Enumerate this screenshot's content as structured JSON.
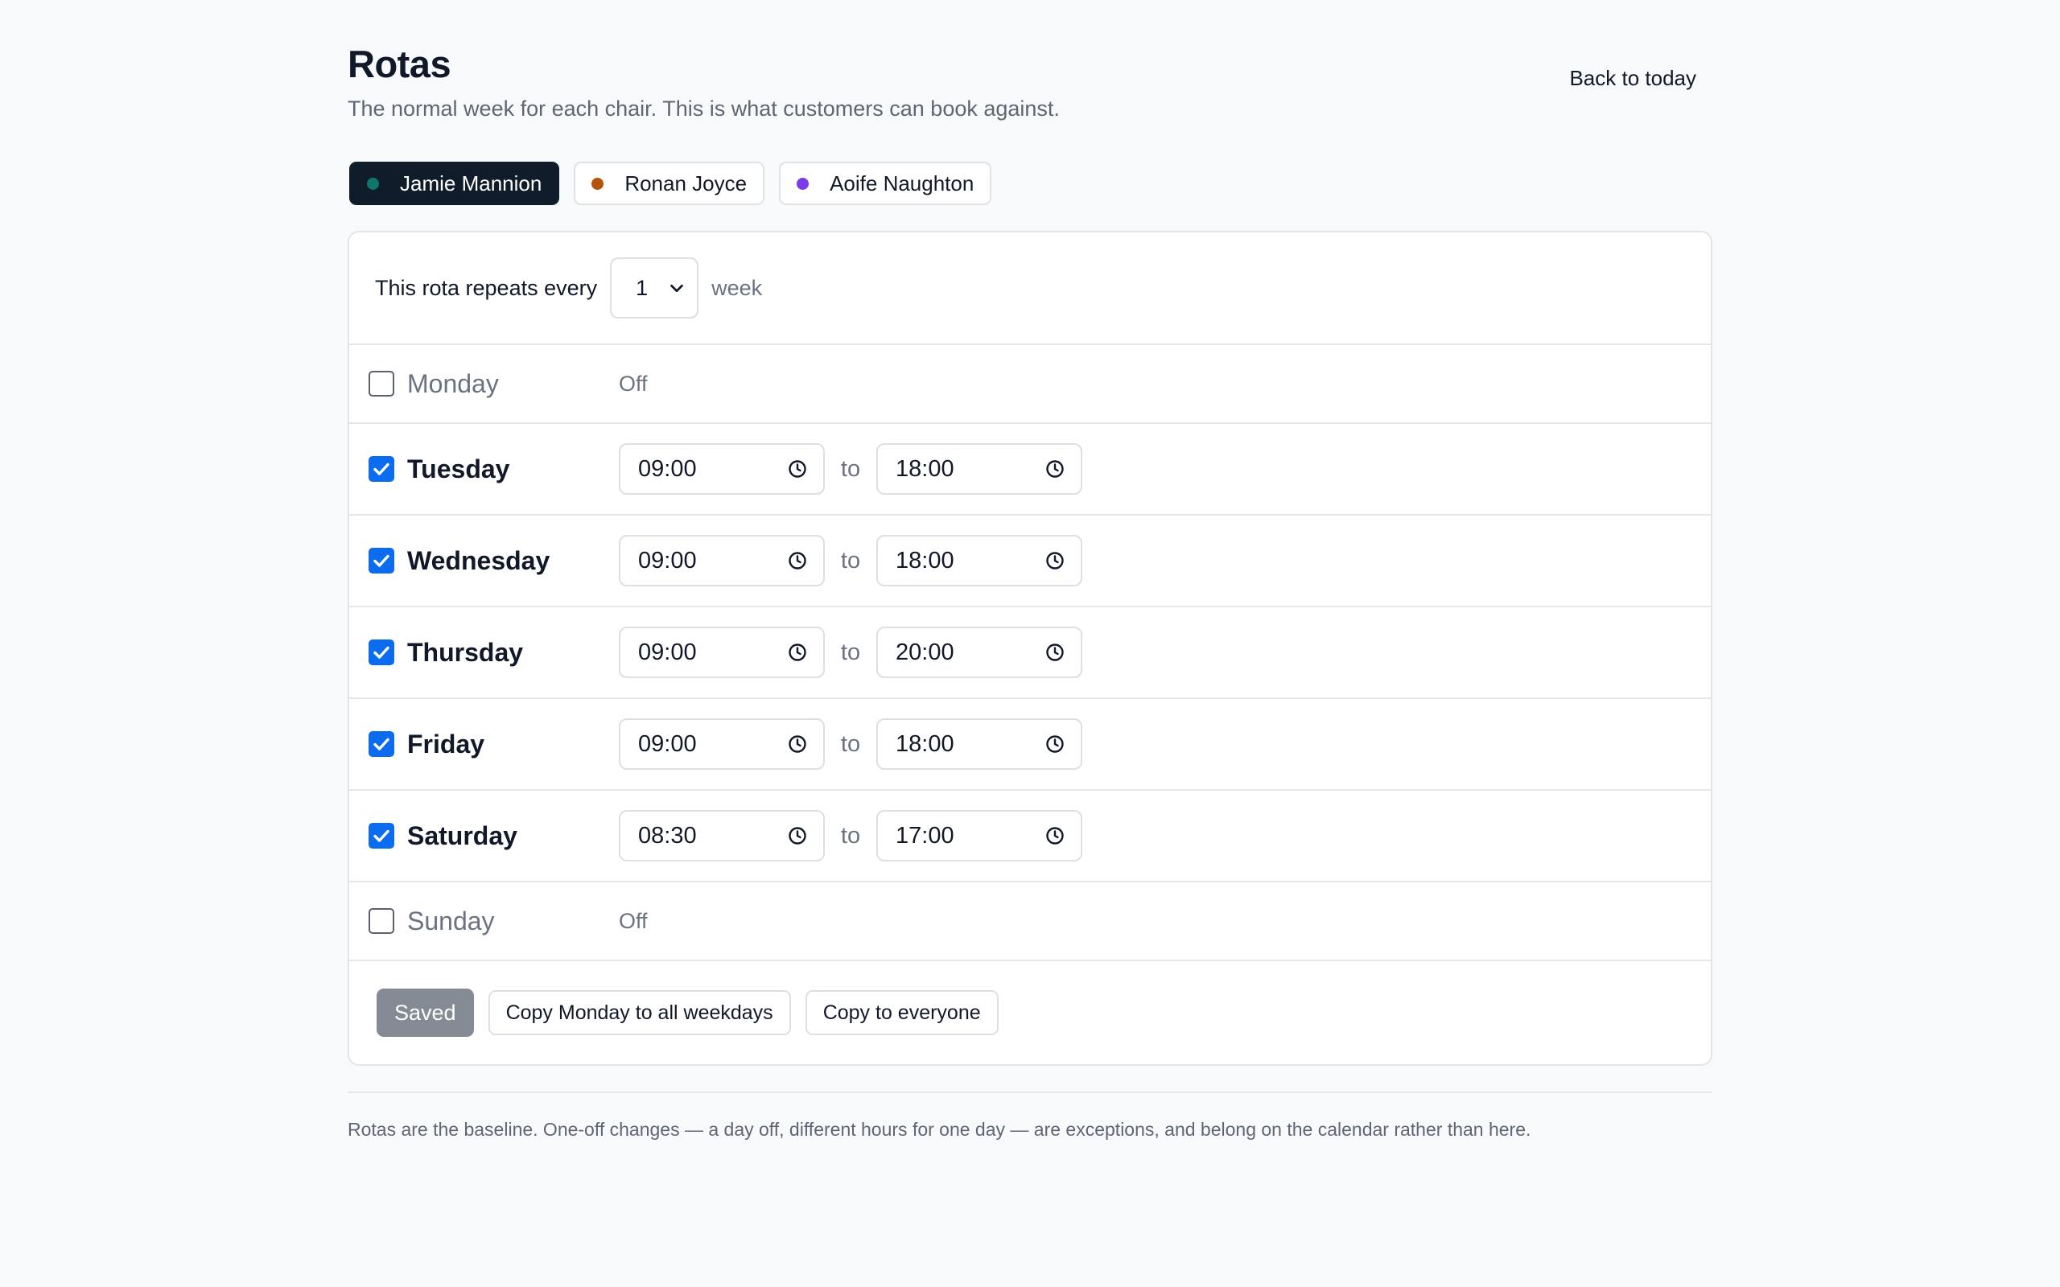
{
  "header": {
    "title": "Rotas",
    "subtitle": "The normal week for each chair. This is what customers can book against.",
    "back_link": "Back to today"
  },
  "staff": [
    {
      "name": "Jamie Mannion",
      "color": "#0f766e",
      "active": true
    },
    {
      "name": "Ronan Joyce",
      "color": "#b45309",
      "active": false
    },
    {
      "name": "Aoife Naughton",
      "color": "#7c3aed",
      "active": false
    }
  ],
  "repeat": {
    "label": "This rota repeats every",
    "value": "1",
    "unit": "week"
  },
  "days": [
    {
      "name": "Monday",
      "enabled": false,
      "off_label": "Off"
    },
    {
      "name": "Tuesday",
      "enabled": true,
      "start": "09:00",
      "end": "18:00",
      "to_label": "to"
    },
    {
      "name": "Wednesday",
      "enabled": true,
      "start": "09:00",
      "end": "18:00",
      "to_label": "to"
    },
    {
      "name": "Thursday",
      "enabled": true,
      "start": "09:00",
      "end": "20:00",
      "to_label": "to"
    },
    {
      "name": "Friday",
      "enabled": true,
      "start": "09:00",
      "end": "18:00",
      "to_label": "to"
    },
    {
      "name": "Saturday",
      "enabled": true,
      "start": "08:30",
      "end": "17:00",
      "to_label": "to"
    },
    {
      "name": "Sunday",
      "enabled": false,
      "off_label": "Off"
    }
  ],
  "actions": {
    "saved": "Saved",
    "copy_monday": "Copy Monday to all weekdays",
    "copy_everyone": "Copy to everyone"
  },
  "footer": {
    "note": "Rotas are the baseline. One-off changes — a day off, different hours for one day — are exceptions, and belong on the calendar rather than here."
  },
  "colors": {
    "accent": "#0b6cf0",
    "active_tab": "#111c2b",
    "saved_button": "#858b95"
  },
  "icons": {
    "checkbox_checked": "checkmark-icon",
    "time": "clock-icon",
    "select": "chevron-down-icon"
  }
}
